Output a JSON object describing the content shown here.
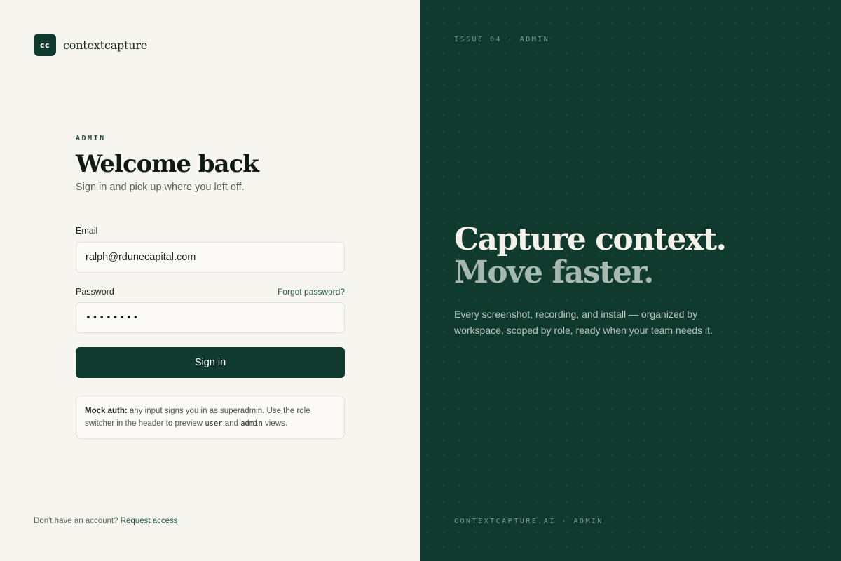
{
  "brand": {
    "logo_text": "cc",
    "name": "contextcapture"
  },
  "form": {
    "eyebrow": "ADMIN",
    "title": "Welcome back",
    "subtitle": "Sign in and pick up where you left off.",
    "email_label": "Email",
    "email_value": "ralph@rdunecapital.com",
    "password_label": "Password",
    "forgot_link": "Forgot password?",
    "password_value": "••••••••",
    "submit_label": "Sign in"
  },
  "note": {
    "bold": "Mock auth:",
    "text_1": " any input signs you in as superadmin. Use the role switcher in the header to preview ",
    "code_1": "user",
    "text_2": " and ",
    "code_2": "admin",
    "text_3": " views."
  },
  "footer_left": {
    "text": "Don't have an account?",
    "link": "Request access"
  },
  "hero": {
    "issue": "ISSUE 04 · ADMIN",
    "headline_1": "Capture context.",
    "headline_2": "Move faster.",
    "description": "Every screenshot, recording, and install — organized by workspace, scoped by role, ready when your team needs it.",
    "footer": "CONTEXTCAPTURE.AI · ADMIN"
  },
  "colors": {
    "brand_green": "#103a2e",
    "page_bg": "#f7f5f0",
    "link_green": "#1f5a44"
  }
}
